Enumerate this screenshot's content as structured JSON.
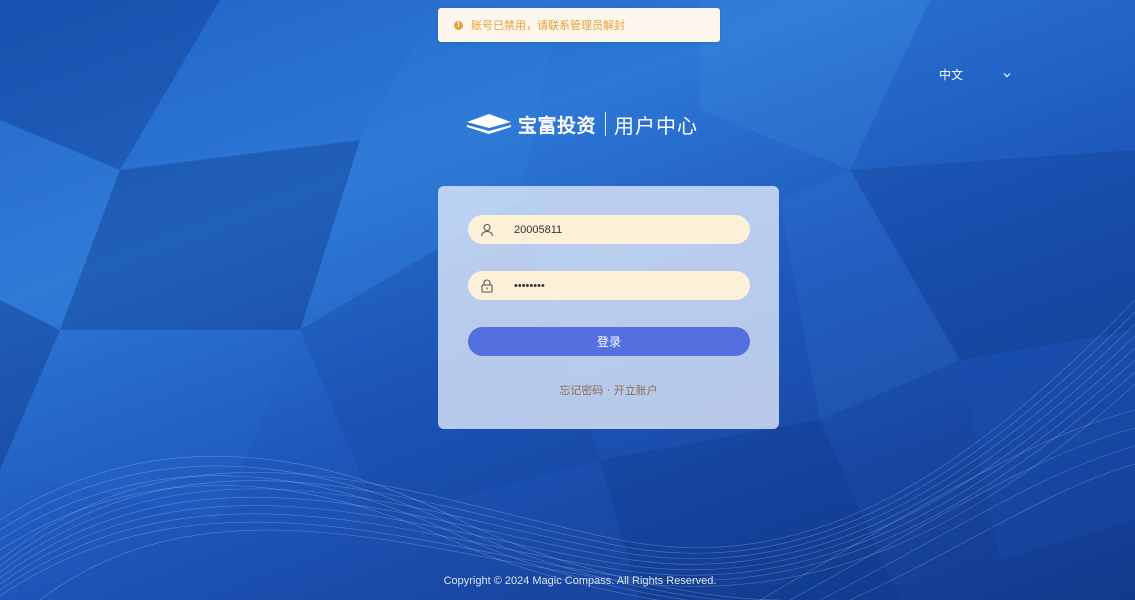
{
  "toast": {
    "icon": "warning-icon",
    "message": "账号已禁用，请联系管理员解封",
    "color": "#e6a23c"
  },
  "language": {
    "selected": "中文",
    "icon": "chevron-down-icon"
  },
  "logo": {
    "brand": "宝富投资",
    "subtitle": "用户中心"
  },
  "login": {
    "username": {
      "icon": "user-icon",
      "value": "20005811"
    },
    "password": {
      "icon": "lock-icon",
      "value": "••••••••"
    },
    "submit_label": "登录",
    "forgot_label": "忘记密码",
    "separator": "·",
    "open_account_label": "开立账户"
  },
  "footer": {
    "copyright": "Copyright © 2024 Magic Compass. All Rights Reserved."
  },
  "colors": {
    "accent": "#5470e0",
    "input_bg": "#fcf0d9",
    "warning": "#e6a23c"
  }
}
